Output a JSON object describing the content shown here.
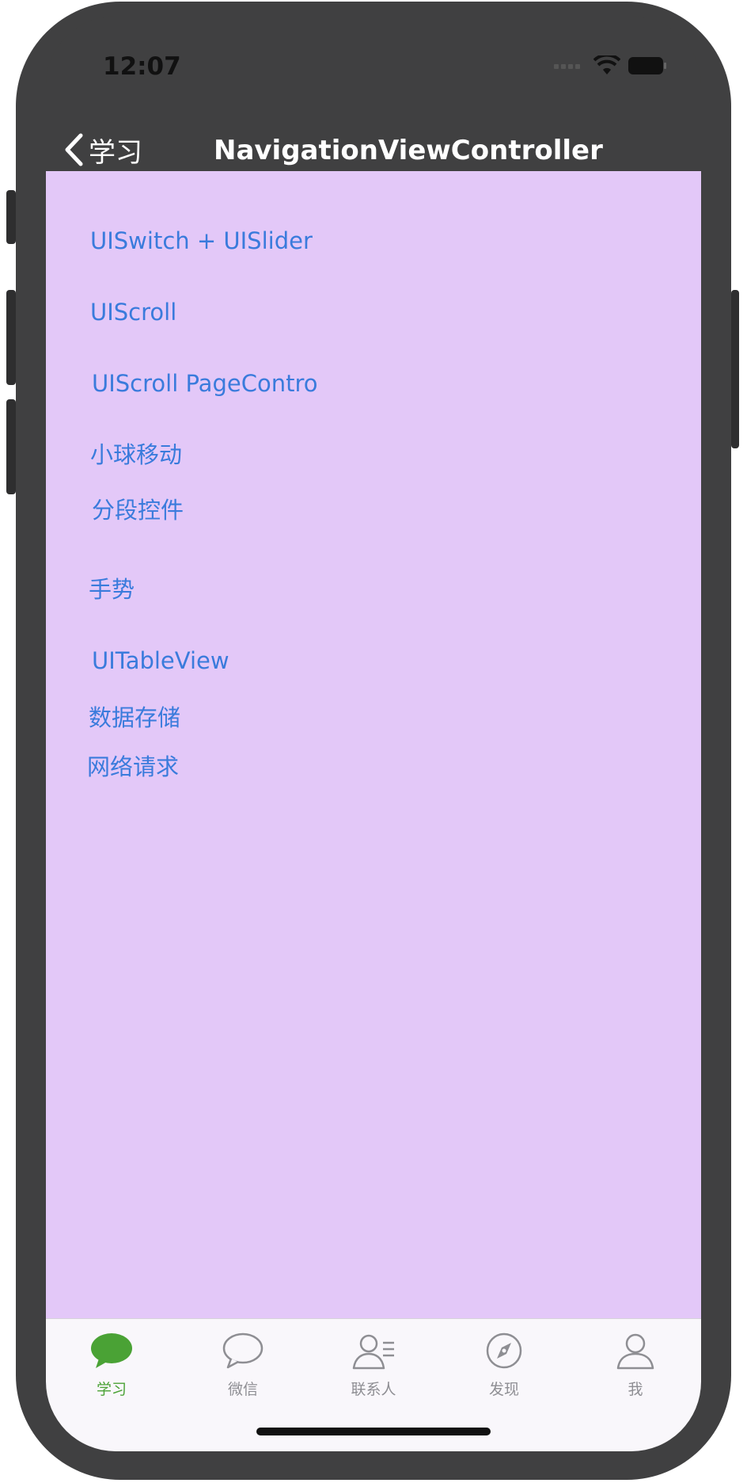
{
  "status_bar": {
    "time": "12:07"
  },
  "nav": {
    "back_label": "学习",
    "title": "NavigationViewController"
  },
  "menu": [
    {
      "label": "UISwitch + UISlider"
    },
    {
      "label": "UIScroll"
    },
    {
      "label": "UIScroll PageContro"
    },
    {
      "label": "小球移动"
    },
    {
      "label": "分段控件"
    },
    {
      "label": "手势"
    },
    {
      "label": "UITableView"
    },
    {
      "label": "数据存储"
    },
    {
      "label": "网络请求"
    }
  ],
  "tabs": [
    {
      "label": "学习",
      "icon": "chat-bubble-filled-icon",
      "active": true
    },
    {
      "label": "微信",
      "icon": "chat-bubble-icon",
      "active": false
    },
    {
      "label": "联系人",
      "icon": "contacts-icon",
      "active": false
    },
    {
      "label": "发现",
      "icon": "compass-icon",
      "active": false
    },
    {
      "label": "我",
      "icon": "person-icon",
      "active": false
    }
  ],
  "colors": {
    "frame": "#404041",
    "content_background": "#e3c8f8",
    "link": "#3a7bdc",
    "tab_active": "#4aa235",
    "tab_inactive": "#8e8e93"
  }
}
